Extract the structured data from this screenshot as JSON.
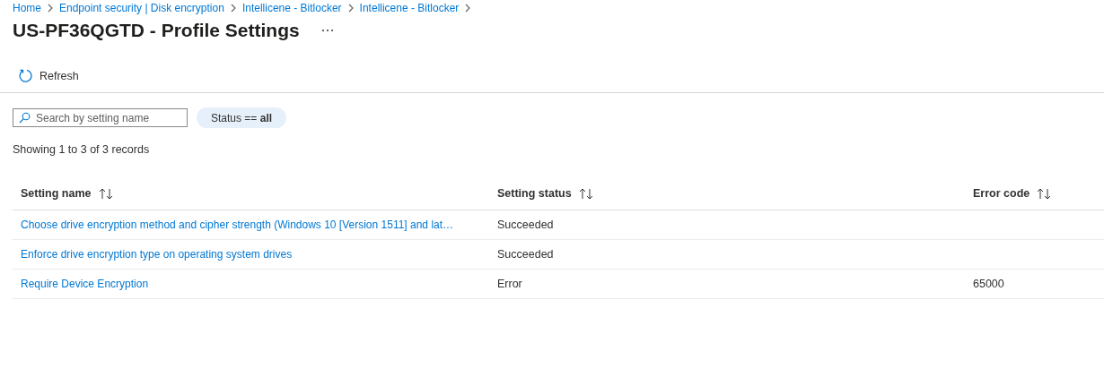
{
  "breadcrumb": [
    "Home",
    "Endpoint security | Disk encryption",
    "Intellicene - Bitlocker",
    "Intellicene - Bitlocker"
  ],
  "title": "US-PF36QGTD - Profile Settings",
  "toolbar": {
    "refresh": "Refresh"
  },
  "search": {
    "placeholder": "Search by setting name"
  },
  "filter": {
    "label": "Status == ",
    "value": "all"
  },
  "summary": "Showing 1 to 3 of 3 records",
  "table": {
    "columns": [
      "Setting name",
      "Setting status",
      "Error code"
    ],
    "rows": [
      {
        "name": "Choose drive encryption method and cipher strength (Windows 10 [Version 1511] and lat…",
        "status": "Succeeded"
      },
      {
        "name": "Enforce drive encryption type on operating system drives",
        "status": "Succeeded"
      },
      {
        "name": "Require Device Encryption",
        "status": "Error",
        "error_code": "65000"
      }
    ]
  }
}
